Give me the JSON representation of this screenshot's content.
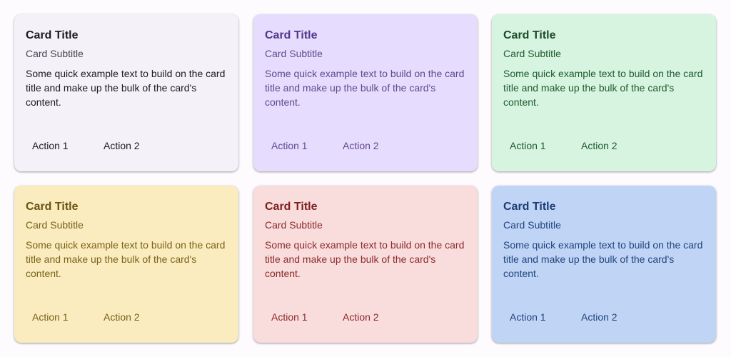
{
  "cards": [
    {
      "title": "Card Title",
      "subtitle": "Card Subtitle",
      "body": "Some quick example text to build on the card title and make up the bulk of the card's content.",
      "action1": "Action 1",
      "action2": "Action 2",
      "colors": {
        "bg": "#f4f2f8",
        "title": "#1d1b20",
        "subtitle": "#49454f",
        "text": "#1d1b20"
      }
    },
    {
      "title": "Card Title",
      "subtitle": "Card Subtitle",
      "body": "Some quick example text to build on the card title and make up the bulk of the card's content.",
      "action1": "Action 1",
      "action2": "Action 2",
      "colors": {
        "bg": "#e6dcfd",
        "title": "#4f378b",
        "subtitle": "#5f4a8f",
        "text": "#5f4a8f"
      }
    },
    {
      "title": "Card Title",
      "subtitle": "Card Subtitle",
      "body": "Some quick example text to build on the card title and make up the bulk of the card's content.",
      "action1": "Action 1",
      "action2": "Action 2",
      "colors": {
        "bg": "#d6f4df",
        "title": "#1c4a2a",
        "subtitle": "#1f5a31",
        "text": "#1f5a31"
      }
    },
    {
      "title": "Card Title",
      "subtitle": "Card Subtitle",
      "body": "Some quick example text to build on the card title and make up the bulk of the card's content.",
      "action1": "Action 1",
      "action2": "Action 2",
      "colors": {
        "bg": "#faecbf",
        "title": "#6b5310",
        "subtitle": "#7a6118",
        "text": "#7a6118"
      }
    },
    {
      "title": "Card Title",
      "subtitle": "Card Subtitle",
      "body": "Some quick example text to build on the card title and make up the bulk of the card's content.",
      "action1": "Action 1",
      "action2": "Action 2",
      "colors": {
        "bg": "#f9dcdc",
        "title": "#7e2020",
        "subtitle": "#8c2a2a",
        "text": "#8c2a2a"
      }
    },
    {
      "title": "Card Title",
      "subtitle": "Card Subtitle",
      "body": "Some quick example text to build on the card title and make up the bulk of the card's content.",
      "action1": "Action 1",
      "action2": "Action 2",
      "colors": {
        "bg": "#c0d5f5",
        "title": "#1b3c73",
        "subtitle": "#1f437e",
        "text": "#1f437e"
      }
    }
  ]
}
